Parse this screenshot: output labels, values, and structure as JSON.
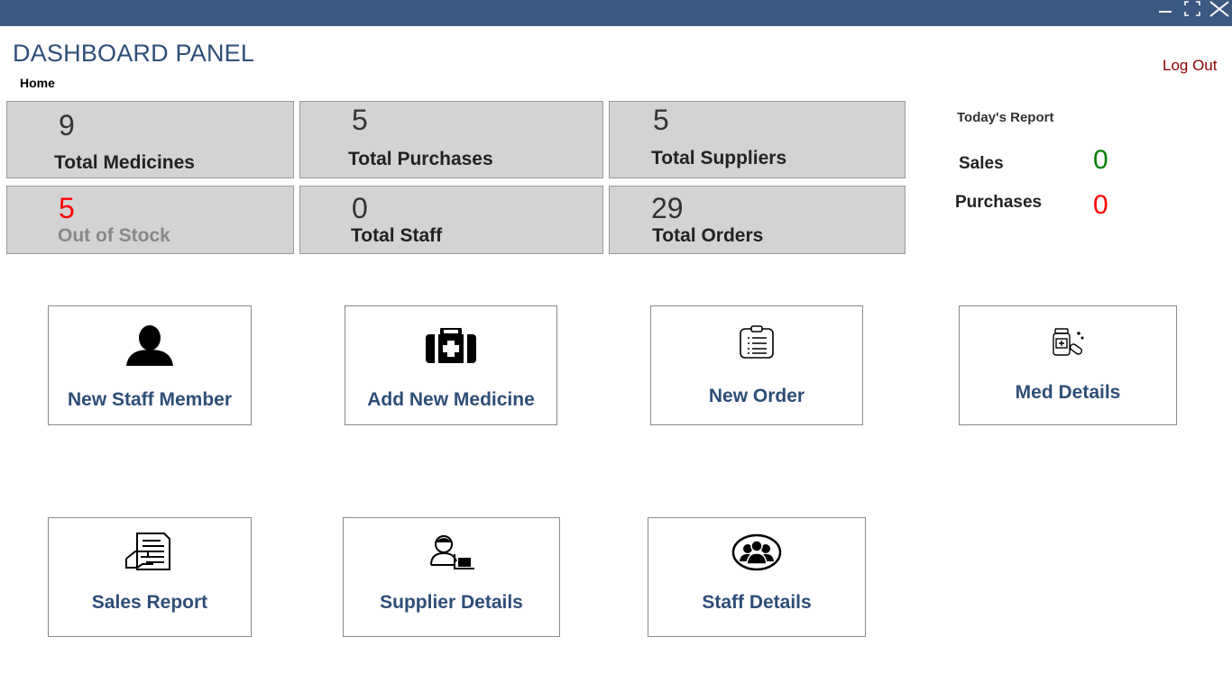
{
  "window": {
    "controls": {
      "minimize_icon": "minimize-icon",
      "maximize_icon": "maximize-icon",
      "close_icon": "close-icon"
    }
  },
  "header": {
    "title": "DASHBOARD PANEL",
    "breadcrumb": "Home",
    "logout_label": "Log Out"
  },
  "stats": [
    {
      "value": "9",
      "label": "Total Medicines"
    },
    {
      "value": "5",
      "label": "Total Purchases"
    },
    {
      "value": "5",
      "label": "Total Suppliers"
    },
    {
      "value": "5",
      "label": "Out of Stock"
    },
    {
      "value": "0",
      "label": "Total Staff"
    },
    {
      "value": "29",
      "label": "Total Orders"
    }
  ],
  "report": {
    "title": "Today's Report",
    "sales_label": "Sales",
    "sales_value": "0",
    "purchases_label": "Purchases",
    "purchases_value": "0"
  },
  "tiles": [
    {
      "label": "New Staff Member",
      "icon": "user-silhouette-icon"
    },
    {
      "label": "Add New Medicine",
      "icon": "first-aid-kit-icon"
    },
    {
      "label": "New Order",
      "icon": "clipboard-list-icon"
    },
    {
      "label": "Med Details",
      "icon": "medicine-bottle-icon"
    },
    {
      "label": "Sales Report",
      "icon": "sales-report-icon"
    },
    {
      "label": "Supplier Details",
      "icon": "supplier-icon"
    },
    {
      "label": "Staff Details",
      "icon": "staff-group-icon"
    }
  ],
  "colors": {
    "titlebar": "#3a5880",
    "title_text": "#2e4e78",
    "logout": "#8b0000",
    "stat_bg": "#d3d3d3",
    "out_of_stock_value": "#ff0000",
    "out_of_stock_label": "#888888",
    "sales_value": "#008000",
    "purchases_value": "#ff0000"
  }
}
